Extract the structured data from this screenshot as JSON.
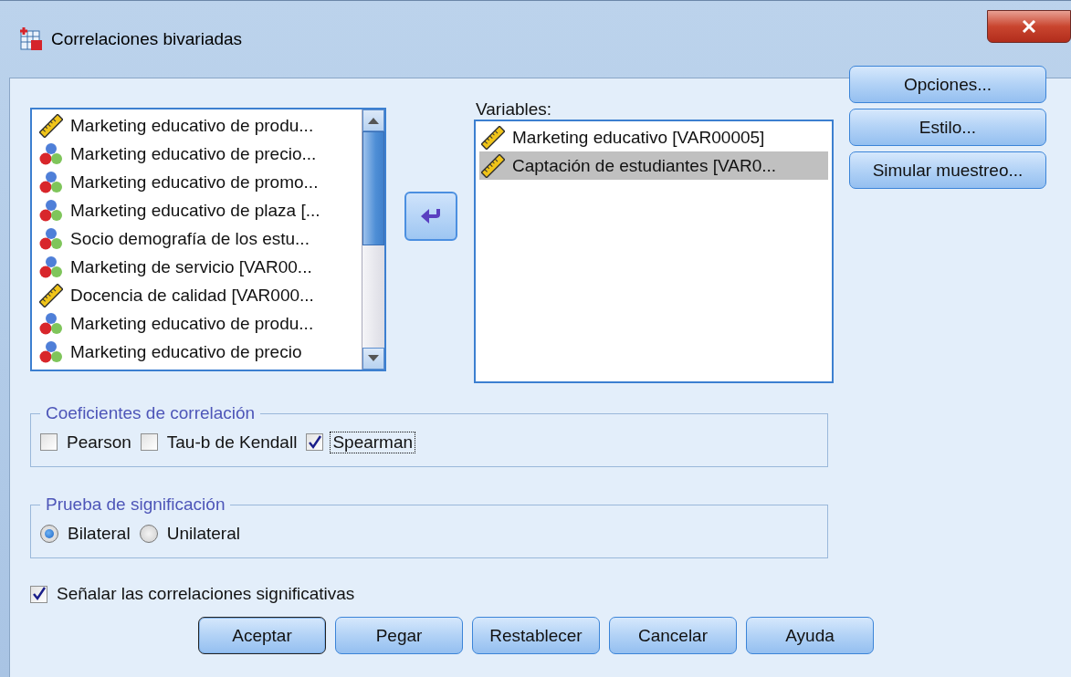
{
  "window": {
    "title": "Correlaciones bivariadas"
  },
  "source_list": {
    "items": [
      {
        "label": "Marketing educativo de produ...",
        "kind": "scale"
      },
      {
        "label": "Marketing educativo de precio...",
        "kind": "nominal"
      },
      {
        "label": "Marketing educativo de promo...",
        "kind": "nominal"
      },
      {
        "label": "Marketing educativo de plaza [...",
        "kind": "nominal"
      },
      {
        "label": "Socio demografía de los estu...",
        "kind": "nominal"
      },
      {
        "label": "Marketing de servicio [VAR00...",
        "kind": "nominal"
      },
      {
        "label": "Docencia de calidad [VAR000...",
        "kind": "scale"
      },
      {
        "label": "Marketing educativo de produ...",
        "kind": "nominal"
      },
      {
        "label": "Marketing educativo de precio",
        "kind": "nominal"
      }
    ]
  },
  "variables": {
    "label": "Variables:",
    "items": [
      {
        "label": "Marketing educativo [VAR00005]",
        "kind": "scale",
        "selected": false
      },
      {
        "label": "Captación de estudiantes [VAR0...",
        "kind": "scale",
        "selected": true
      }
    ]
  },
  "side_buttons": [
    "Opciones...",
    "Estilo...",
    "Simular muestreo..."
  ],
  "correlation_group": {
    "title": "Coeficientes de correlación",
    "options": [
      {
        "label": "Pearson",
        "checked": false,
        "focused": false
      },
      {
        "label": "Tau-b de Kendall",
        "checked": false,
        "focused": false
      },
      {
        "label": "Spearman",
        "checked": true,
        "focused": true
      }
    ]
  },
  "significance_group": {
    "title": "Prueba de significación",
    "options": [
      {
        "label": "Bilateral",
        "selected": true
      },
      {
        "label": "Unilateral",
        "selected": false
      }
    ]
  },
  "flag_option": {
    "label": "Señalar las correlaciones significativas",
    "checked": true
  },
  "buttons": [
    {
      "label": "Aceptar",
      "default": true
    },
    {
      "label": "Pegar",
      "default": false
    },
    {
      "label": "Restablecer",
      "default": false
    },
    {
      "label": "Cancelar",
      "default": false
    },
    {
      "label": "Ayuda",
      "default": false
    }
  ]
}
